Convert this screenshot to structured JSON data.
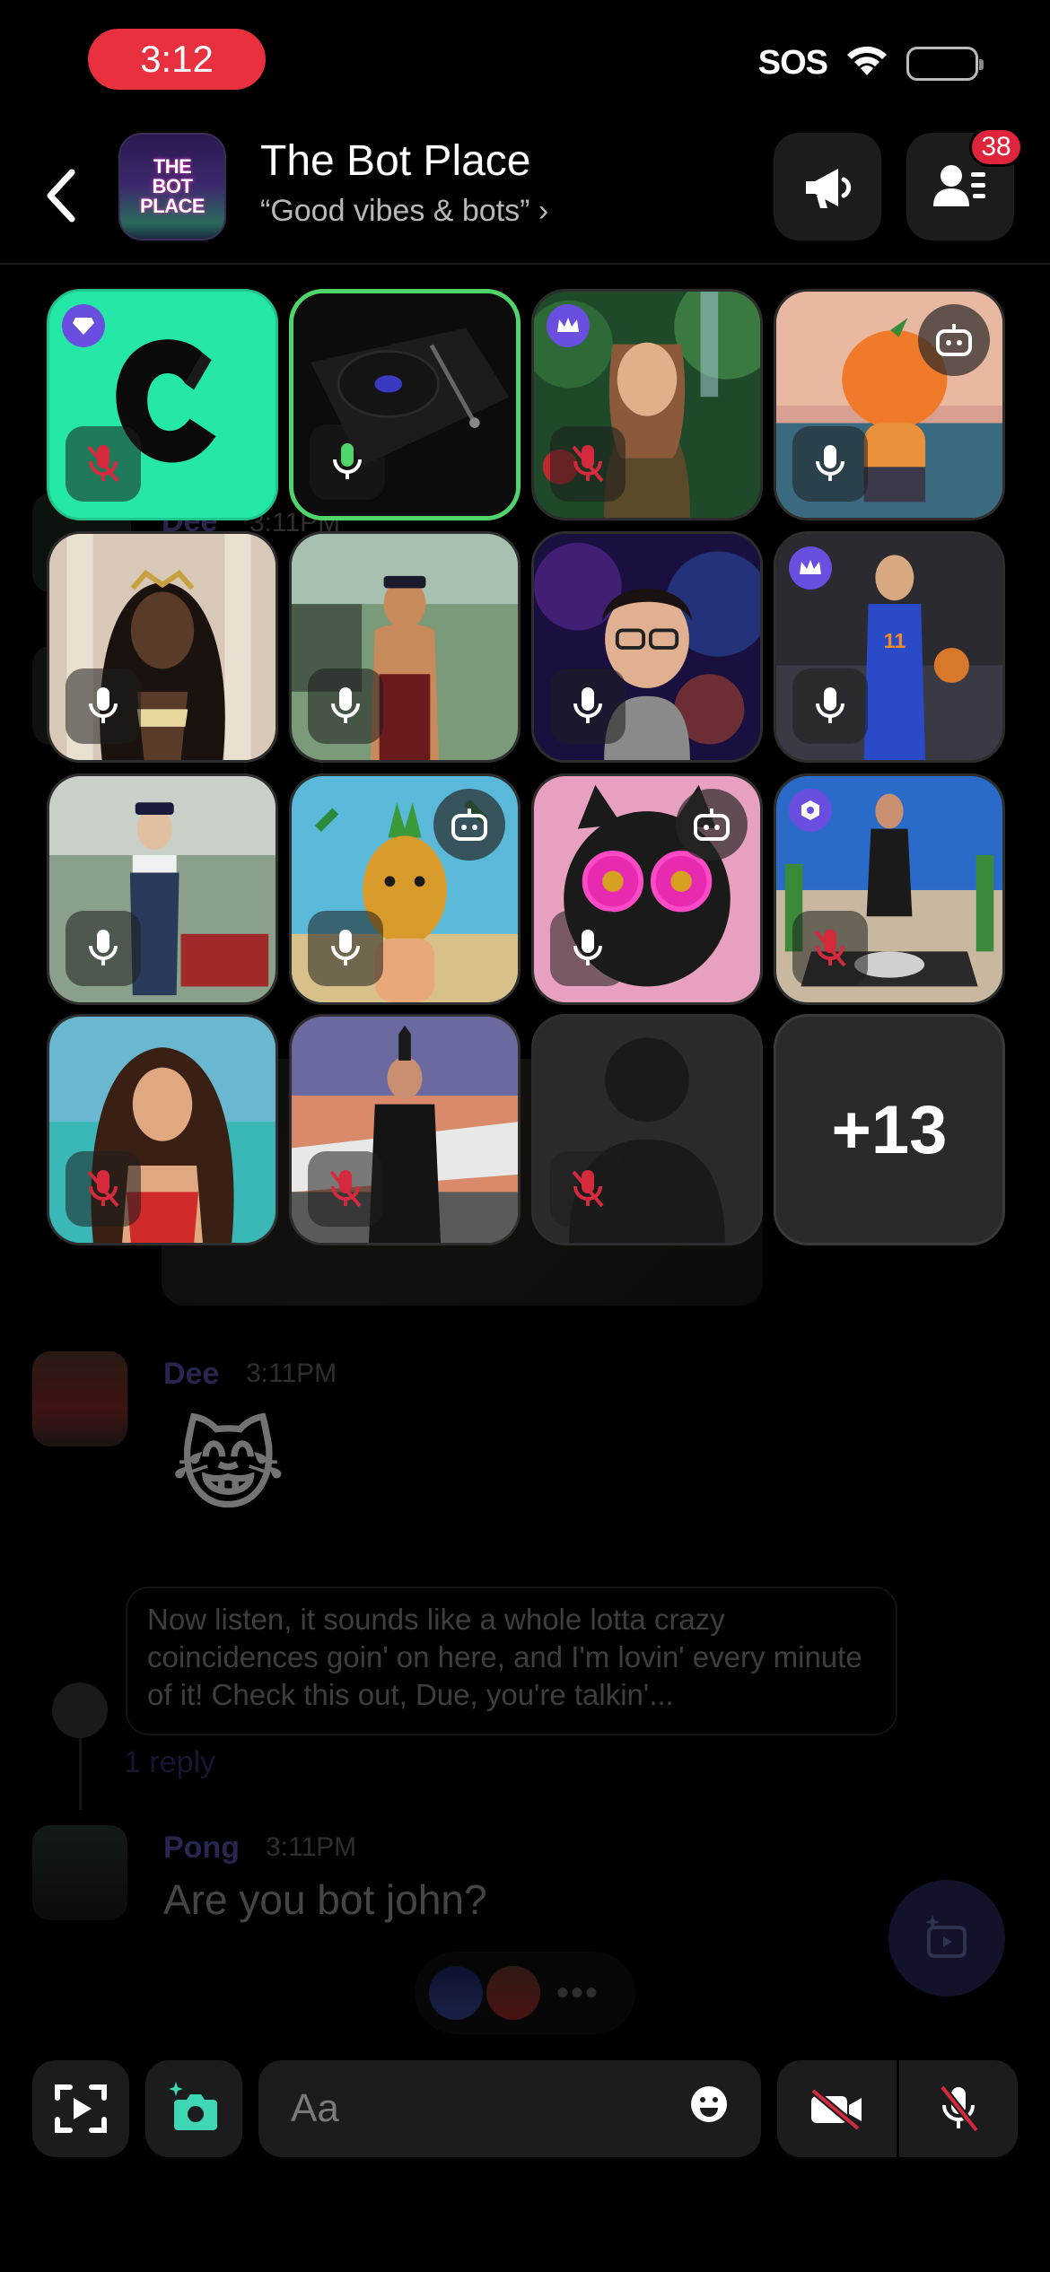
{
  "status_bar": {
    "time": "3:12",
    "network": "SOS",
    "time_bg": "#e8303f"
  },
  "header": {
    "avatar_lines": [
      "THE",
      "BOT",
      "PLACE"
    ],
    "title": "The Bot Place",
    "subtitle": "“Good vibes & bots” ›",
    "members_badge": "38"
  },
  "grid": {
    "more_label": "+13",
    "tiles": [
      {
        "name": "letter-c-bot",
        "corner": "diamond",
        "mic": "muted",
        "speaking": false
      },
      {
        "name": "record-player",
        "mic": "on",
        "speaking": true
      },
      {
        "name": "jungle-explorer",
        "corner": "crown",
        "mic": "muted",
        "speaking": false
      },
      {
        "name": "orange-character",
        "bot": true,
        "mic": "on",
        "speaking": false
      },
      {
        "name": "goddess",
        "mic": "on",
        "speaking": false
      },
      {
        "name": "train-conductor-man",
        "mic": "on",
        "speaking": false
      },
      {
        "name": "glasses-guy",
        "mic": "on",
        "speaking": false
      },
      {
        "name": "knicks-player",
        "corner": "crown",
        "mic": "on",
        "speaking": false
      },
      {
        "name": "train-conductor-woman",
        "mic": "on",
        "speaking": false
      },
      {
        "name": "pineapple-character",
        "bot": true,
        "mic": "on",
        "speaking": false
      },
      {
        "name": "pink-glasses-cat",
        "bot": true,
        "mic": "on",
        "speaking": false
      },
      {
        "name": "race-driver",
        "corner": "hex",
        "mic": "muted",
        "speaking": false
      },
      {
        "name": "beach-woman",
        "mic": "muted",
        "speaking": false
      },
      {
        "name": "jet-man",
        "mic": "muted",
        "speaking": false
      },
      {
        "name": "placeholder-user",
        "mic": "muted",
        "speaking": false
      }
    ]
  },
  "chat": {
    "background_rows": [
      {
        "name": "Dee",
        "time": "3:11PM"
      }
    ],
    "messages": [
      {
        "author": "Dee",
        "time": "3:11PM",
        "content_emoji": "😹"
      },
      {
        "reply_preview": "Now listen, it sounds like a whole lotta crazy coincidences goin' on here, and I'm lovin' every minute of it! Check this out, Due, you're talkin'...",
        "reply_count": "1 reply"
      },
      {
        "author": "Pong",
        "time": "3:11PM",
        "text": "Are you bot john?"
      }
    ],
    "reactors_more": "•••"
  },
  "composer": {
    "placeholder": "Aa"
  },
  "colors": {
    "accent": "#6a4ee0",
    "speaking": "#4fd56a",
    "muted_red": "#d42a3c",
    "name_purple": "#5a55b0"
  }
}
